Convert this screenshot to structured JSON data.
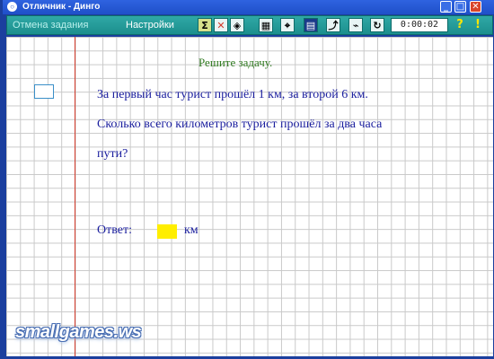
{
  "window": {
    "title": "Отличник - Динго",
    "minimize_label": "_",
    "maximize_label": "□",
    "close_label": "✕"
  },
  "toolbar": {
    "cancel_label": "Отмена задания",
    "settings_label": "Настройки",
    "tools": [
      {
        "icon": "sum-icon",
        "glyph": "Σ"
      },
      {
        "icon": "x-icon",
        "glyph": "✕"
      },
      {
        "icon": "eraser-icon",
        "glyph": "◈"
      },
      {
        "icon": "grid-icon",
        "glyph": "▦"
      },
      {
        "icon": "pin-icon",
        "glyph": "⌖"
      },
      {
        "icon": "lines-icon",
        "glyph": "▤"
      },
      {
        "icon": "chart-icon",
        "glyph": "⤴"
      },
      {
        "icon": "ruler-icon",
        "glyph": "⌁"
      },
      {
        "icon": "refresh-icon",
        "glyph": "↻"
      }
    ],
    "timer": "0:00:02",
    "help_label": "?",
    "alert_label": "!"
  },
  "task": {
    "heading": "Решите задачу.",
    "text": "За первый час турист прошёл 1 км, за второй 6 км. Сколько всего километров турист прошёл за два часа пути?",
    "answer_label": "Ответ:",
    "answer_value": "",
    "unit": "км"
  },
  "watermark": "smallgames.ws",
  "colors": {
    "titlebar": "#1f4fc8",
    "toolbar": "#2fa8a6",
    "margin_line": "#d23a2a",
    "heading": "#2f7a1f",
    "text": "#1a1e9e",
    "answer_box": "#ffee00"
  }
}
